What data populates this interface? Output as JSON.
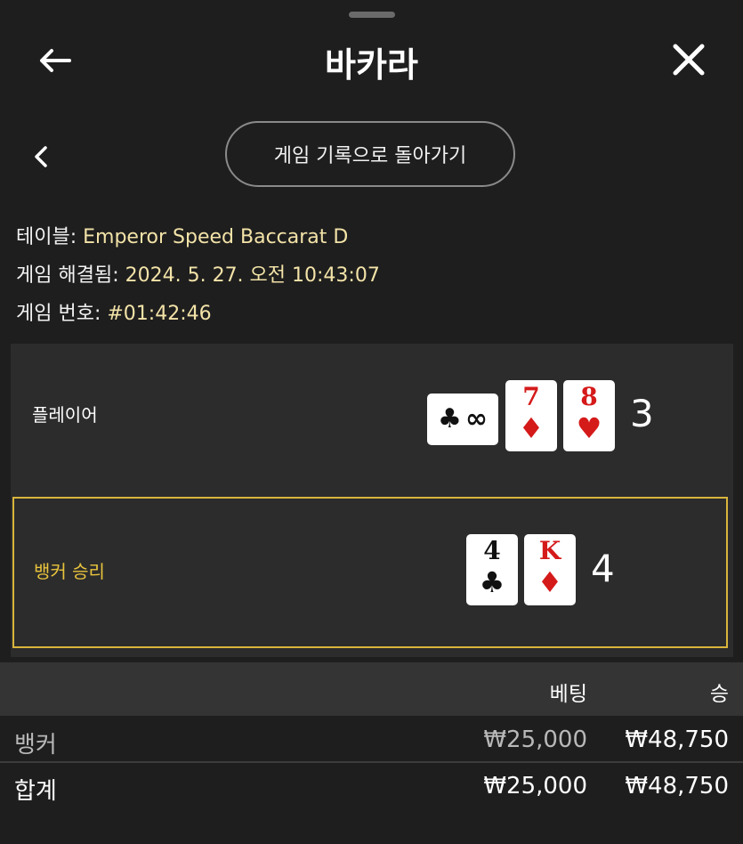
{
  "header": {
    "title": "바카라"
  },
  "nav": {
    "back_to_history_label": "게임 기록으로 돌아가기"
  },
  "info": {
    "table_label": "테이블: ",
    "table_value": "Emperor Speed Baccarat D",
    "resolved_label": "게임 해결됨: ",
    "resolved_value": "2024. 5. 27. 오전 10:43:07",
    "game_no_label": "게임 번호: ",
    "game_no_value": "#01:42:46"
  },
  "round": {
    "player": {
      "label": "플레이어",
      "score": "3",
      "cards": [
        {
          "rank": "∞",
          "suit": "♣",
          "color": "black",
          "orientation": "sideways"
        },
        {
          "rank": "7",
          "suit": "♦",
          "color": "red"
        },
        {
          "rank": "8",
          "suit": "♥",
          "color": "red"
        }
      ]
    },
    "banker": {
      "label": "뱅커 승리",
      "score": "4",
      "cards": [
        {
          "rank": "4",
          "suit": "♣",
          "color": "black"
        },
        {
          "rank": "K",
          "suit": "♦",
          "color": "red"
        }
      ]
    }
  },
  "bets": {
    "columns": {
      "bet": "베팅",
      "win": "승"
    },
    "rows": [
      {
        "name": "뱅커",
        "bet": "₩25,000",
        "win": "₩48,750"
      }
    ],
    "total": {
      "name": "합계",
      "bet": "₩25,000",
      "win": "₩48,750"
    }
  },
  "colors": {
    "accent_gold": "#e9c43d",
    "card_red": "#d51a1a",
    "value_text": "#f3e3a8"
  },
  "icons": {
    "back": "arrow-left-icon",
    "close": "close-icon",
    "prev": "chevron-left-icon"
  }
}
